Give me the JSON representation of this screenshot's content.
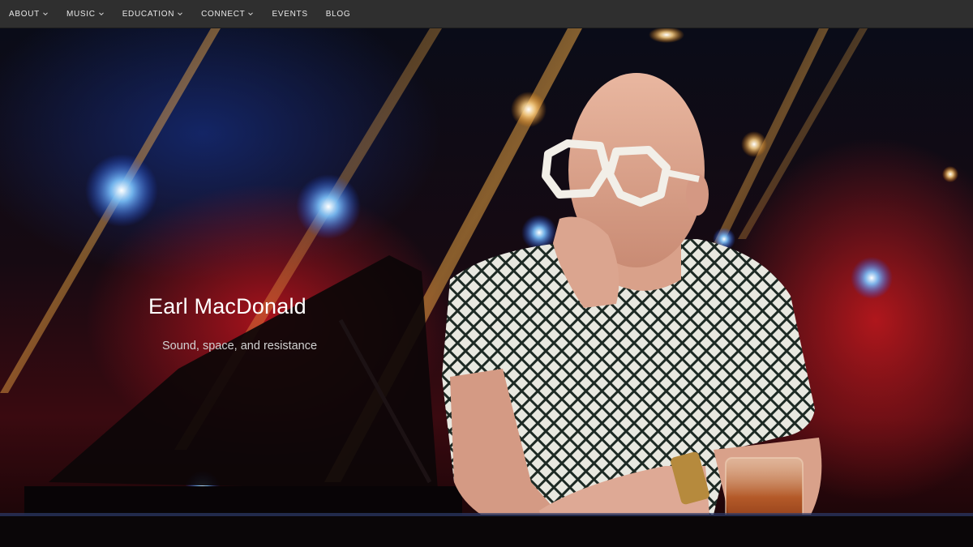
{
  "nav": {
    "items": [
      {
        "label": "ABOUT",
        "has_dropdown": true
      },
      {
        "label": "MUSIC",
        "has_dropdown": true
      },
      {
        "label": "EDUCATION",
        "has_dropdown": true
      },
      {
        "label": "CONNECT",
        "has_dropdown": true
      },
      {
        "label": "EVENTS",
        "has_dropdown": false
      },
      {
        "label": "BLOG",
        "has_dropdown": false
      }
    ]
  },
  "hero": {
    "title": "Earl MacDonald",
    "tagline": "Sound, space, and resistance",
    "colors": {
      "nav_bg": "#2f2f2f",
      "stage_red": "#c0141e",
      "light_blue": "#4aa8ff",
      "light_gold": "#ffb347"
    }
  }
}
